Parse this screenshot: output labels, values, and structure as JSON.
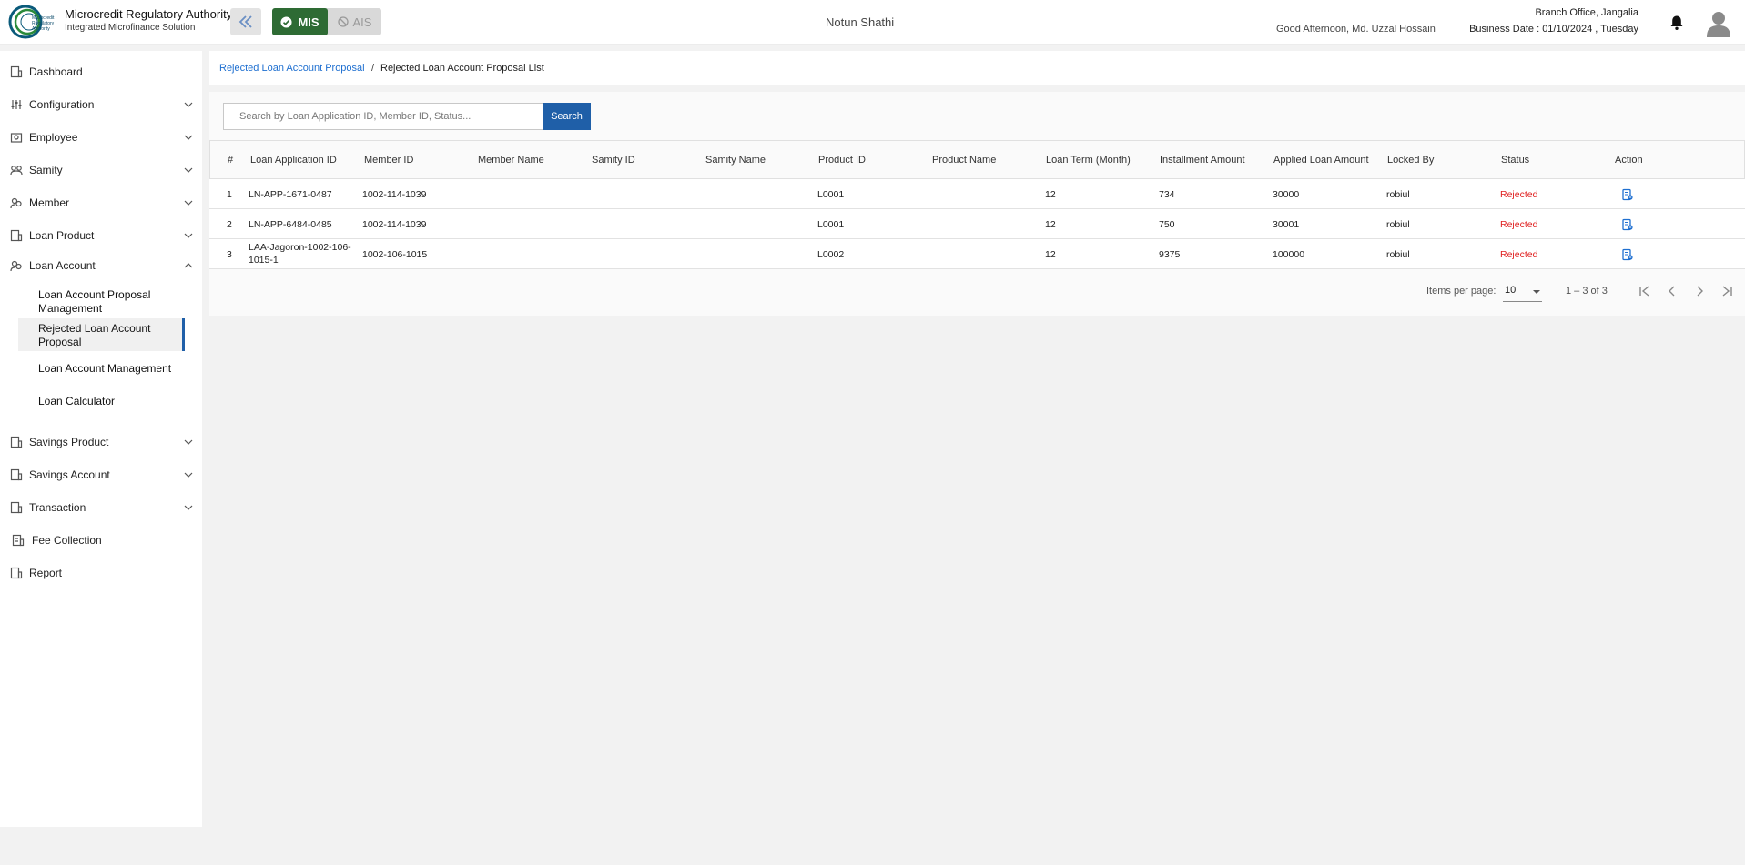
{
  "header": {
    "logo_text": "Microcredit Regulatory Authority",
    "brand_title": "Microcredit Regulatory Authority",
    "brand_subtitle": "Integrated Microfinance Solution",
    "mode_mis": "MIS",
    "mode_ais": "AIS",
    "center_title": "Notun Shathi",
    "greeting": "Good Afternoon, Md. Uzzal Hossain",
    "branch": "Branch Office, Jangalia",
    "business_date": "Business Date : 01/10/2024 , Tuesday"
  },
  "sidebar": {
    "items": [
      {
        "label": "Dashboard"
      },
      {
        "label": "Configuration"
      },
      {
        "label": "Employee"
      },
      {
        "label": "Samity"
      },
      {
        "label": "Member"
      },
      {
        "label": "Loan Product"
      },
      {
        "label": "Loan Account"
      },
      {
        "label": "Savings Product"
      },
      {
        "label": "Savings Account"
      },
      {
        "label": "Transaction"
      },
      {
        "label": "Fee Collection"
      },
      {
        "label": "Report"
      }
    ],
    "loan_account_sub": [
      {
        "label_line1": "Loan Account Proposal",
        "label_line2": "Management"
      },
      {
        "label_line1": "Rejected Loan Account",
        "label_line2": "Proposal"
      },
      {
        "label_line1": "Loan Account Management",
        "label_line2": ""
      },
      {
        "label_line1": "Loan Calculator",
        "label_line2": ""
      }
    ]
  },
  "breadcrumb": {
    "link": "Rejected Loan Account Proposal",
    "separator": "/",
    "current": "Rejected Loan Account Proposal List"
  },
  "search": {
    "placeholder": "Search by Loan Application ID, Member ID, Status...",
    "button": "Search"
  },
  "table": {
    "headers": [
      "#",
      "Loan Application ID",
      "Member ID",
      "Member Name",
      "Samity ID",
      "Samity Name",
      "Product ID",
      "Product Name",
      "Loan Term (Month)",
      "Installment Amount",
      "Applied Loan Amount",
      "Locked By",
      "Status",
      "Action"
    ],
    "rows": [
      {
        "num": "1",
        "app_id_1": "LN-APP-1671-0487",
        "app_id_2": "",
        "member_id": "1002-114-1039",
        "member_name": "",
        "samity_id": "",
        "samity_name": "",
        "product_id": "L0001",
        "product_name": "",
        "term": "12",
        "installment": "734",
        "applied": "30000",
        "locked_by": "robiul",
        "status": "Rejected"
      },
      {
        "num": "2",
        "app_id_1": "LN-APP-6484-0485",
        "app_id_2": "",
        "member_id": "1002-114-1039",
        "member_name": "",
        "samity_id": "",
        "samity_name": "",
        "product_id": "L0001",
        "product_name": "",
        "term": "12",
        "installment": "750",
        "applied": "30001",
        "locked_by": "robiul",
        "status": "Rejected"
      },
      {
        "num": "3",
        "app_id_1": "LAA-Jagoron-1002-106-",
        "app_id_2": "1015-1",
        "member_id": "1002-106-1015",
        "member_name": "",
        "samity_id": "",
        "samity_name": "",
        "product_id": "L0002",
        "product_name": "",
        "term": "12",
        "installment": "9375",
        "applied": "100000",
        "locked_by": "robiul",
        "status": "Rejected"
      }
    ]
  },
  "paginator": {
    "items_per_page_label": "Items per page:",
    "page_size": "10",
    "range": "1 – 3 of 3"
  },
  "colors": {
    "primary": "#1f5fa8",
    "mis_active": "#2e6b34",
    "rejected": "#e02020",
    "link": "#1e6fd0"
  }
}
